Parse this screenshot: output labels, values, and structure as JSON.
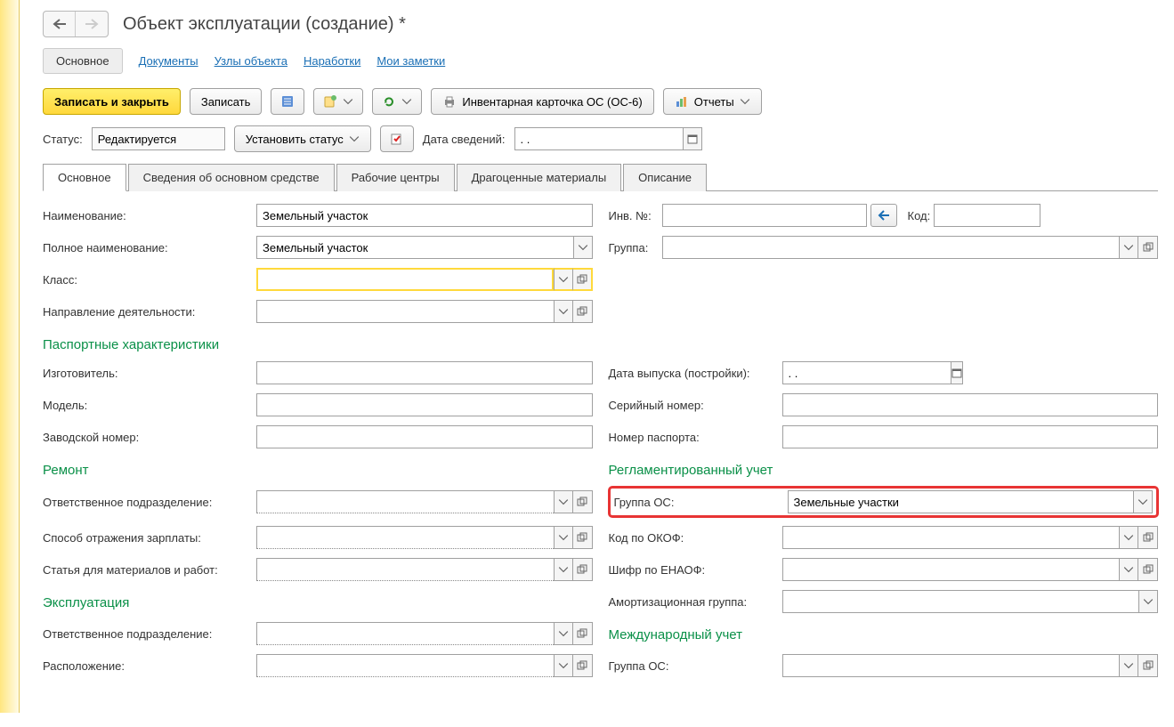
{
  "title": "Объект эксплуатации (создание) *",
  "navTabs": {
    "main": "Основное",
    "docs": "Документы",
    "nodes": "Узлы объекта",
    "workings": "Наработки",
    "notes": "Мои заметки"
  },
  "toolbar": {
    "saveClose": "Записать и закрыть",
    "save": "Записать",
    "inventoryCard": "Инвентарная карточка ОС (ОС-6)",
    "reports": "Отчеты"
  },
  "statusRow": {
    "statusLabel": "Статус:",
    "statusValue": "Редактируется",
    "setStatus": "Установить статус",
    "infoDateLabel": "Дата сведений:",
    "infoDateValue": ". ."
  },
  "sectionTabs": {
    "main": "Основное",
    "fixedAssetInfo": "Сведения об основном средстве",
    "workCenters": "Рабочие центры",
    "preciousMaterials": "Драгоценные материалы",
    "description": "Описание"
  },
  "fields": {
    "name": {
      "label": "Наименование:",
      "value": "Земельный участок"
    },
    "invNo": {
      "label": "Инв. №:",
      "value": ""
    },
    "code": {
      "label": "Код:",
      "value": ""
    },
    "fullName": {
      "label": "Полное наименование:",
      "value": "Земельный участок"
    },
    "group": {
      "label": "Группа:",
      "value": ""
    },
    "class": {
      "label": "Класс:",
      "value": ""
    },
    "activityDirection": {
      "label": "Направление деятельности:",
      "value": ""
    }
  },
  "headings": {
    "passport": "Паспортные характеристики",
    "repair": "Ремонт",
    "regulatedAccounting": "Регламентированный учет",
    "operation": "Эксплуатация",
    "intlAccounting": "Международный учет"
  },
  "passport": {
    "manufacturer": {
      "label": "Изготовитель:",
      "value": ""
    },
    "model": {
      "label": "Модель:",
      "value": ""
    },
    "factoryNumber": {
      "label": "Заводской номер:",
      "value": ""
    },
    "releaseDate": {
      "label": "Дата выпуска (постройки):",
      "value": ". ."
    },
    "serialNumber": {
      "label": "Серийный номер:",
      "value": ""
    },
    "passportNumber": {
      "label": "Номер паспорта:",
      "value": ""
    }
  },
  "repair": {
    "respDept": {
      "label": "Ответственное подразделение:",
      "value": ""
    },
    "salaryMethod": {
      "label": "Способ отражения зарплаты:",
      "value": ""
    },
    "materialsArticle": {
      "label": "Статья для материалов и работ:",
      "value": ""
    }
  },
  "regulated": {
    "osGroup": {
      "label": "Группа ОС:",
      "value": "Земельные участки"
    },
    "okofCode": {
      "label": "Код по ОКОФ:",
      "value": ""
    },
    "enaofCode": {
      "label": "Шифр по ЕНАОФ:",
      "value": ""
    },
    "amortGroup": {
      "label": "Амортизационная группа:",
      "value": ""
    }
  },
  "operation": {
    "respDept": {
      "label": "Ответственное подразделение:",
      "value": ""
    },
    "location": {
      "label": "Расположение:",
      "value": ""
    }
  },
  "intl": {
    "osGroup": {
      "label": "Группа ОС:",
      "value": ""
    }
  }
}
